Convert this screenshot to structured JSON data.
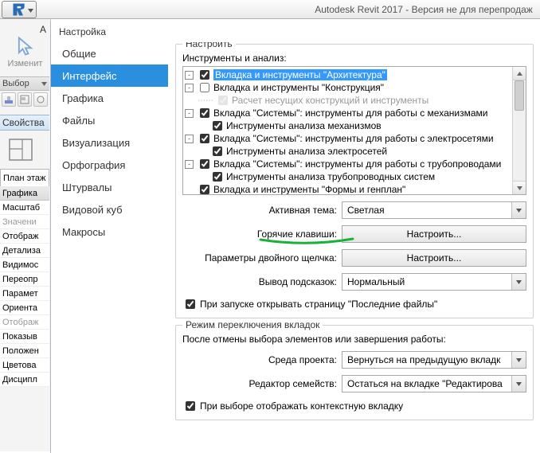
{
  "titlebar": {
    "title": "Autodesk Revit 2017 - Версия не для перепродаж"
  },
  "ribbon": {
    "modify_label": "Изменит",
    "left_truncated": "А",
    "selection_panel": "Выбор",
    "props_panel": "Свойства",
    "plan_tab": "План этаж"
  },
  "props": {
    "graphics_header": "Графика",
    "rows": [
      {
        "label": "Масштаб",
        "dim": false
      },
      {
        "label": "Значени",
        "dim": true
      },
      {
        "label": "Отображ",
        "dim": false
      },
      {
        "label": "Детализа",
        "dim": false
      },
      {
        "label": "Видимос",
        "dim": false
      },
      {
        "label": "Переопр",
        "dim": false
      },
      {
        "label": "Парамет",
        "dim": false
      },
      {
        "label": "Ориента",
        "dim": false
      },
      {
        "label": "Отображ",
        "dim": true
      },
      {
        "label": "Показыв",
        "dim": false
      },
      {
        "label": "Положен",
        "dim": false
      },
      {
        "label": "Цветова",
        "dim": false
      },
      {
        "label": "Дисципл",
        "dim": false
      }
    ]
  },
  "dialog": {
    "title": "Настройка",
    "sidebar": [
      {
        "label": "Общие",
        "selected": false
      },
      {
        "label": "Интерфейс",
        "selected": true
      },
      {
        "label": "Графика",
        "selected": false
      },
      {
        "label": "Файлы",
        "selected": false
      },
      {
        "label": "Визуализация",
        "selected": false
      },
      {
        "label": "Орфография",
        "selected": false
      },
      {
        "label": "Штурвалы",
        "selected": false
      },
      {
        "label": "Видовой куб",
        "selected": false
      },
      {
        "label": "Макросы",
        "selected": false
      }
    ],
    "group_configure": "Настроить",
    "tools_label": "Инструменты и анализ:",
    "tree": [
      {
        "level": 0,
        "expand": "-",
        "checked": true,
        "label": "Вкладка и инструменты \"Архитектура\"",
        "selected": true
      },
      {
        "level": 0,
        "expand": "-",
        "checked": false,
        "label": "Вкладка и инструменты \"Конструкция\""
      },
      {
        "level": 1,
        "disabled": true,
        "checked": true,
        "label": "Расчет несущих конструкций и инструменты",
        "dash": true
      },
      {
        "level": 0,
        "expand": "-",
        "checked": true,
        "label": "Вкладка \"Системы\": инструменты для работы с механизмами"
      },
      {
        "level": 1,
        "checked": true,
        "label": "Инструменты анализа механизмов"
      },
      {
        "level": 0,
        "expand": "-",
        "checked": true,
        "label": "Вкладка \"Системы\": инструменты для работы с электросетями"
      },
      {
        "level": 1,
        "checked": true,
        "label": "Инструменты анализа электросетей"
      },
      {
        "level": 0,
        "expand": "-",
        "checked": true,
        "label": "Вкладка \"Системы\": инструменты для работы с трубопроводами"
      },
      {
        "level": 1,
        "checked": true,
        "label": "Инструменты анализа трубопроводных систем"
      },
      {
        "level": 0,
        "expand": "",
        "checked": true,
        "label": "Вкладка и инструменты \"Формы и генплан\""
      }
    ],
    "theme_label": "Активная тема:",
    "theme_value": "Светлая",
    "shortcuts_label": "Горячие клавиши:",
    "shortcuts_btn": "Настроить...",
    "dblclick_label": "Параметры двойного щелчка:",
    "dblclick_btn": "Настроить...",
    "tooltip_label": "Вывод подсказок:",
    "tooltip_value": "Нормальный",
    "recent_cb": "При запуске открывать страницу \"Последние файлы\"",
    "group_tabs": "Режим переключения вкладок",
    "after_deselect": "После отмены выбора элементов или завершения работы:",
    "env_label": "Среда проекта:",
    "env_value": "Вернуться на предыдущую вкладк",
    "fam_label": "Редактор семейств:",
    "fam_value": "Остаться на вкладке \"Редактирова",
    "context_cb": "При выборе отображать контекстную вкладку"
  }
}
